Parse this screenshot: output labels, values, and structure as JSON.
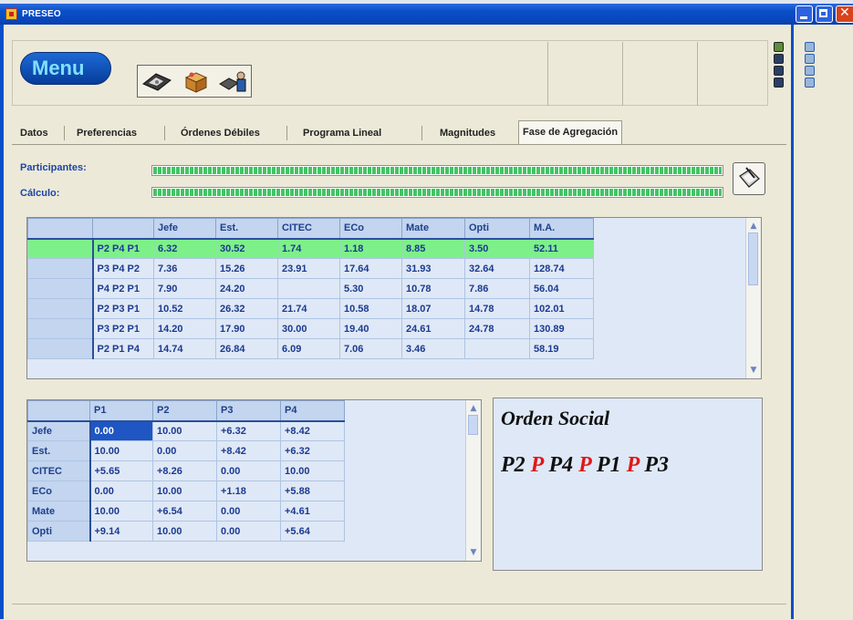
{
  "window": {
    "title": "PRESEO",
    "accent": "#0A4FC8",
    "controls": [
      "minimize-icon",
      "maximize-icon",
      "close-icon"
    ]
  },
  "menu": {
    "label": "Menu",
    "toolbar_icons": [
      "save-disk-icon",
      "package-icon",
      "user-terminal-icon"
    ]
  },
  "tabs": [
    {
      "label": "Datos",
      "active": false
    },
    {
      "label": "Preferencias",
      "active": false
    },
    {
      "label": "Órdenes Débiles",
      "active": false
    },
    {
      "label": "Programa Lineal",
      "active": false
    },
    {
      "label": "Magnitudes",
      "active": false
    },
    {
      "label": "Fase de Agregación",
      "active": true
    }
  ],
  "progress": {
    "participants_label": "Participantes:",
    "participants_fill": 1.0,
    "calc_label": "Cálculo:",
    "calc_fill": 1.0,
    "calc_button_icon": "clipboard-pen-icon",
    "fill_color": "#43C463"
  },
  "results_grid": {
    "headers": [
      "",
      "",
      "Jefe",
      "Est.",
      "CITEC",
      "ECo",
      "Mate",
      "Opti",
      "M.A."
    ],
    "highlight_color": "#7EF08A",
    "rows": [
      {
        "order": "P2 P4 P1",
        "values": [
          "6.32",
          "30.52",
          "1.74",
          "1.18",
          "8.85",
          "3.50",
          "52.11"
        ],
        "highlighted": true
      },
      {
        "order": "P3 P4 P2",
        "values": [
          "7.36",
          "15.26",
          "23.91",
          "17.64",
          "31.93",
          "32.64",
          "128.74"
        ],
        "highlighted": false
      },
      {
        "order": "P4 P2 P1",
        "values": [
          "7.90",
          "24.20",
          "",
          "5.30",
          "10.78",
          "7.86",
          "56.04"
        ],
        "highlighted": false
      },
      {
        "order": "P2 P3 P1",
        "values": [
          "10.52",
          "26.32",
          "21.74",
          "10.58",
          "18.07",
          "14.78",
          "102.01"
        ],
        "highlighted": false
      },
      {
        "order": "P3 P2 P1",
        "values": [
          "14.20",
          "17.90",
          "30.00",
          "19.40",
          "24.61",
          "24.78",
          "130.89"
        ],
        "highlighted": false
      },
      {
        "order": "P2 P1 P4",
        "values": [
          "14.74",
          "26.84",
          "6.09",
          "7.06",
          "3.46",
          "",
          "58.19"
        ],
        "highlighted": false
      }
    ]
  },
  "matrix_grid": {
    "headers": [
      "",
      "P1",
      "P2",
      "P3",
      "P4"
    ],
    "selection_color": "#1F56C4",
    "rows": [
      {
        "label": "Jefe",
        "values": [
          "0.00",
          "10.00",
          "+6.32",
          "+8.42"
        ]
      },
      {
        "label": "Est.",
        "values": [
          "10.00",
          "0.00",
          "+8.42",
          "+6.32"
        ]
      },
      {
        "label": "CITEC",
        "values": [
          "+5.65",
          "+8.26",
          "0.00",
          "10.00"
        ]
      },
      {
        "label": "ECo",
        "values": [
          "0.00",
          "10.00",
          "+1.18",
          "+5.88"
        ]
      },
      {
        "label": "Mate",
        "values": [
          "10.00",
          "+6.54",
          "0.00",
          "+4.61"
        ]
      },
      {
        "label": "Opti",
        "values": [
          "+9.14",
          "10.00",
          "0.00",
          "+5.64"
        ]
      }
    ]
  },
  "social_order": {
    "heading": "Orden Social",
    "parts": [
      "P2",
      "P",
      "P4",
      "P",
      "P1",
      "P",
      "P3"
    ],
    "relation_color": "#E01818"
  }
}
